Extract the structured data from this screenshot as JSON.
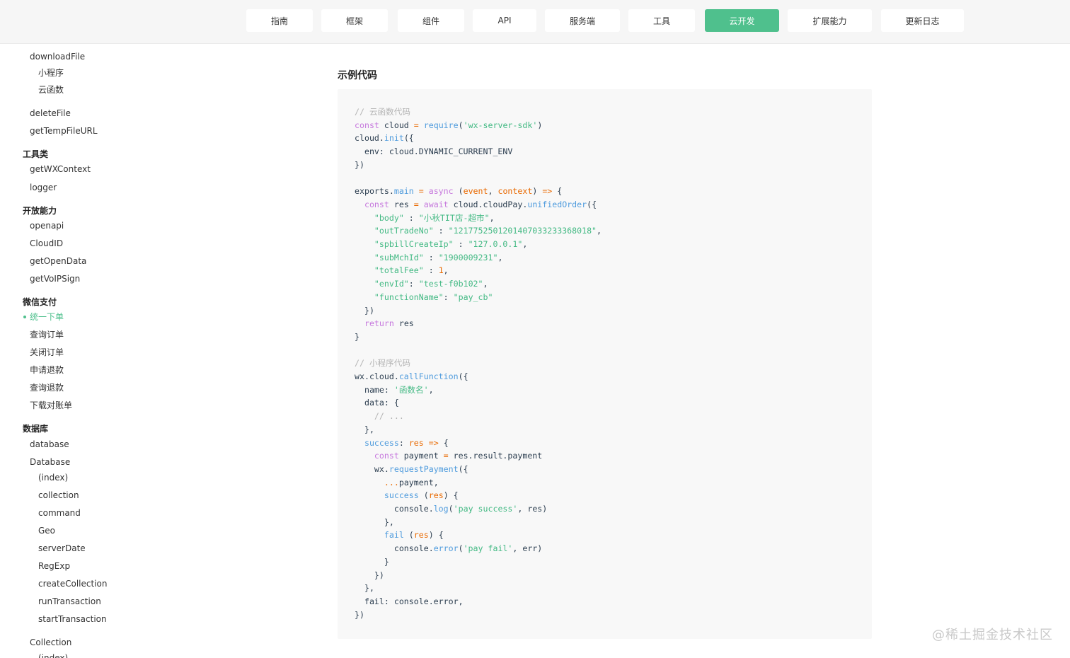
{
  "nav": {
    "items": [
      {
        "label": "指南"
      },
      {
        "label": "框架"
      },
      {
        "label": "组件"
      },
      {
        "label": "API"
      },
      {
        "label": "服务端"
      },
      {
        "label": "工具"
      },
      {
        "label": "云开发",
        "active": true
      },
      {
        "label": "扩展能力"
      },
      {
        "label": "更新日志"
      }
    ],
    "active_color": "#4fc08d"
  },
  "sidebar": {
    "items": [
      {
        "label": "downloadFile"
      },
      {
        "label": "小程序"
      },
      {
        "label": "云函数"
      },
      {
        "label": "deleteFile"
      },
      {
        "label": "getTempFileURL"
      },
      {
        "label": "工具类"
      },
      {
        "label": "getWXContext"
      },
      {
        "label": "logger"
      },
      {
        "label": "开放能力"
      },
      {
        "label": "openapi"
      },
      {
        "label": "CloudID"
      },
      {
        "label": "getOpenData"
      },
      {
        "label": "getVoIPSign"
      },
      {
        "label": "微信支付"
      },
      {
        "label": "统一下单",
        "active": true
      },
      {
        "label": "查询订单"
      },
      {
        "label": "关闭订单"
      },
      {
        "label": "申请退款"
      },
      {
        "label": "查询退款"
      },
      {
        "label": "下载对账单"
      },
      {
        "label": "数据库"
      },
      {
        "label": "database"
      },
      {
        "label": "Database"
      },
      {
        "label": "(index)"
      },
      {
        "label": "collection"
      },
      {
        "label": "command"
      },
      {
        "label": "Geo"
      },
      {
        "label": "serverDate"
      },
      {
        "label": "RegExp"
      },
      {
        "label": "createCollection"
      },
      {
        "label": "runTransaction"
      },
      {
        "label": "startTransaction"
      },
      {
        "label": "Collection"
      },
      {
        "label": "(index)"
      }
    ]
  },
  "main": {
    "section_title": "示例代码",
    "code_lines": [
      [
        [
          "c",
          "// 云函数代码"
        ]
      ],
      [
        [
          "k",
          "const"
        ],
        [
          "p",
          " cloud "
        ],
        [
          "o",
          "="
        ],
        [
          "p",
          " "
        ],
        [
          "f",
          "require"
        ],
        [
          "p",
          "("
        ],
        [
          "s",
          "'wx-server-sdk'"
        ],
        [
          "p",
          ")"
        ]
      ],
      [
        [
          "p",
          "cloud."
        ],
        [
          "f",
          "init"
        ],
        [
          "p",
          "({"
        ]
      ],
      [
        [
          "p",
          "  env: cloud.DYNAMIC_CURRENT_ENV"
        ]
      ],
      [
        [
          "p",
          "})"
        ]
      ],
      [
        [
          "p",
          ""
        ]
      ],
      [
        [
          "p",
          "exports."
        ],
        [
          "f",
          "main"
        ],
        [
          "p",
          " "
        ],
        [
          "o",
          "="
        ],
        [
          "p",
          " "
        ],
        [
          "k",
          "async"
        ],
        [
          "p",
          " ("
        ],
        [
          "a",
          "event"
        ],
        [
          "p",
          ", "
        ],
        [
          "a",
          "context"
        ],
        [
          "p",
          ") "
        ],
        [
          "o",
          "=>"
        ],
        [
          "p",
          " {"
        ]
      ],
      [
        [
          "p",
          "  "
        ],
        [
          "k",
          "const"
        ],
        [
          "p",
          " res "
        ],
        [
          "o",
          "="
        ],
        [
          "p",
          " "
        ],
        [
          "k",
          "await"
        ],
        [
          "p",
          " cloud.cloudPay."
        ],
        [
          "f",
          "unifiedOrder"
        ],
        [
          "p",
          "({"
        ]
      ],
      [
        [
          "p",
          "    "
        ],
        [
          "s",
          "\"body\""
        ],
        [
          "p",
          " : "
        ],
        [
          "s",
          "\"小秋TIT店-超市\""
        ],
        [
          "p",
          ","
        ]
      ],
      [
        [
          "p",
          "    "
        ],
        [
          "s",
          "\"outTradeNo\""
        ],
        [
          "p",
          " : "
        ],
        [
          "s",
          "\"1217752501201407033233368018\""
        ],
        [
          "p",
          ","
        ]
      ],
      [
        [
          "p",
          "    "
        ],
        [
          "s",
          "\"spbillCreateIp\""
        ],
        [
          "p",
          " : "
        ],
        [
          "s",
          "\"127.0.0.1\""
        ],
        [
          "p",
          ","
        ]
      ],
      [
        [
          "p",
          "    "
        ],
        [
          "s",
          "\"subMchId\""
        ],
        [
          "p",
          " : "
        ],
        [
          "s",
          "\"1900009231\""
        ],
        [
          "p",
          ","
        ]
      ],
      [
        [
          "p",
          "    "
        ],
        [
          "s",
          "\"totalFee\""
        ],
        [
          "p",
          " : "
        ],
        [
          "n",
          "1"
        ],
        [
          "p",
          ","
        ]
      ],
      [
        [
          "p",
          "    "
        ],
        [
          "s",
          "\"envId\""
        ],
        [
          "p",
          ": "
        ],
        [
          "s",
          "\"test-f0b102\""
        ],
        [
          "p",
          ","
        ]
      ],
      [
        [
          "p",
          "    "
        ],
        [
          "s",
          "\"functionName\""
        ],
        [
          "p",
          ": "
        ],
        [
          "s",
          "\"pay_cb\""
        ]
      ],
      [
        [
          "p",
          "  })"
        ]
      ],
      [
        [
          "p",
          "  "
        ],
        [
          "k",
          "return"
        ],
        [
          "p",
          " res"
        ]
      ],
      [
        [
          "p",
          "}"
        ]
      ],
      [
        [
          "p",
          ""
        ]
      ],
      [
        [
          "c",
          "// 小程序代码"
        ]
      ],
      [
        [
          "p",
          "wx.cloud."
        ],
        [
          "f",
          "callFunction"
        ],
        [
          "p",
          "({"
        ]
      ],
      [
        [
          "p",
          "  name: "
        ],
        [
          "s",
          "'函数名'"
        ],
        [
          "p",
          ","
        ]
      ],
      [
        [
          "p",
          "  data: {"
        ]
      ],
      [
        [
          "c",
          "    // ..."
        ]
      ],
      [
        [
          "p",
          "  },"
        ]
      ],
      [
        [
          "p",
          "  "
        ],
        [
          "f",
          "success"
        ],
        [
          "p",
          ": "
        ],
        [
          "a",
          "res"
        ],
        [
          "p",
          " "
        ],
        [
          "o",
          "=>"
        ],
        [
          "p",
          " {"
        ]
      ],
      [
        [
          "p",
          "    "
        ],
        [
          "k",
          "const"
        ],
        [
          "p",
          " payment "
        ],
        [
          "o",
          "="
        ],
        [
          "p",
          " res.result.payment"
        ]
      ],
      [
        [
          "p",
          "    wx."
        ],
        [
          "f",
          "requestPayment"
        ],
        [
          "p",
          "({"
        ]
      ],
      [
        [
          "p",
          "      "
        ],
        [
          "o",
          "..."
        ],
        [
          "p",
          "payment,"
        ]
      ],
      [
        [
          "p",
          "      "
        ],
        [
          "f",
          "success"
        ],
        [
          "p",
          " ("
        ],
        [
          "a",
          "res"
        ],
        [
          "p",
          ") {"
        ]
      ],
      [
        [
          "p",
          "        console."
        ],
        [
          "f",
          "log"
        ],
        [
          "p",
          "("
        ],
        [
          "s",
          "'pay success'"
        ],
        [
          "p",
          ", res)"
        ]
      ],
      [
        [
          "p",
          "      },"
        ]
      ],
      [
        [
          "p",
          "      "
        ],
        [
          "f",
          "fail"
        ],
        [
          "p",
          " ("
        ],
        [
          "a",
          "res"
        ],
        [
          "p",
          ") {"
        ]
      ],
      [
        [
          "p",
          "        console."
        ],
        [
          "f",
          "error"
        ],
        [
          "p",
          "("
        ],
        [
          "s",
          "'pay fail'"
        ],
        [
          "p",
          ", err)"
        ]
      ],
      [
        [
          "p",
          "      }"
        ]
      ],
      [
        [
          "p",
          "    })"
        ]
      ],
      [
        [
          "p",
          "  },"
        ]
      ],
      [
        [
          "p",
          "  fail: console.error,"
        ]
      ],
      [
        [
          "p",
          "})"
        ]
      ]
    ]
  },
  "watermark": "@稀土掘金技术社区"
}
